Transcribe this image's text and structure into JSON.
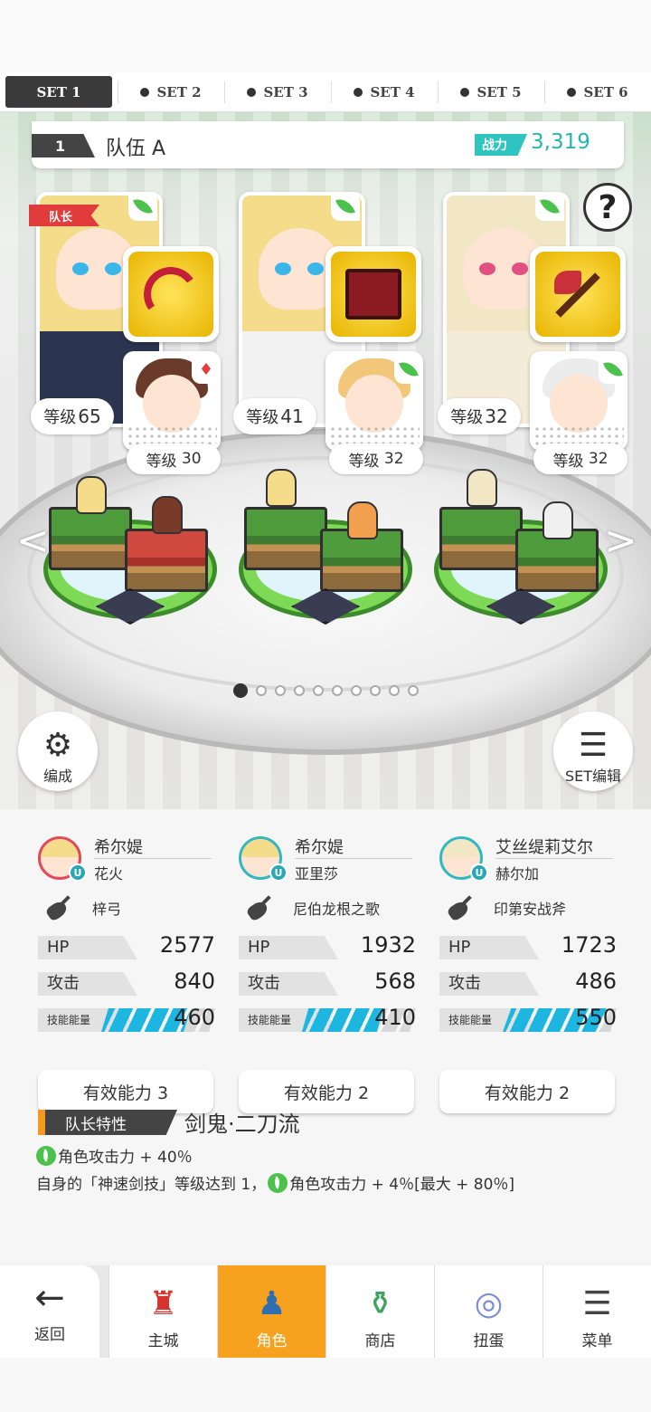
{
  "set_tabs": [
    {
      "label": "SET 1",
      "active": true
    },
    {
      "label": "SET 2",
      "active": false
    },
    {
      "label": "SET 3",
      "active": false
    },
    {
      "label": "SET 4",
      "active": false
    },
    {
      "label": "SET 5",
      "active": false
    },
    {
      "label": "SET 6",
      "active": false
    }
  ],
  "team": {
    "number": "1",
    "name": "队伍 A",
    "power_label": "战力",
    "power_value": "3,319"
  },
  "help_glyph": "?",
  "leader_tag": "队长",
  "characters": [
    {
      "level_label": "等级",
      "level": "65",
      "sub_level_label": "等级",
      "sub_level": "30",
      "weapon_icon": "bow-icon",
      "hair": "#f4dc8a",
      "eye": "#3ab6e8",
      "sub_hair": "#6a3a2a",
      "outfit": "#2b3550"
    },
    {
      "level_label": "等级",
      "level": "41",
      "sub_level_label": "等级",
      "sub_level": "32",
      "weapon_icon": "book-icon",
      "hair": "#f4dc8a",
      "eye": "#3ab6e8",
      "sub_hair": "#f2c77a",
      "outfit": "#f2f2f2"
    },
    {
      "level_label": "等级",
      "level": "32",
      "sub_level_label": "等级",
      "sub_level": "32",
      "weapon_icon": "axe-icon",
      "hair": "#f1e7c4",
      "eye": "#e05080",
      "sub_hair": "#ececec",
      "outfit": "#f4ecd8"
    }
  ],
  "page_dots": {
    "total": 10,
    "active": 0
  },
  "buttons": {
    "formation": "编成",
    "set_edit": "SET编辑"
  },
  "members": [
    {
      "name": "希尔媞",
      "outfit": "花火",
      "badge": "U",
      "weapon": "梓弓",
      "hp_label": "HP",
      "hp": "2577",
      "atk_label": "攻击",
      "atk": "840",
      "energy_label": "技能能量",
      "energy": "460",
      "energy_fill": 0.55,
      "ability": "有效能力 3",
      "hair": "#f4dc8a"
    },
    {
      "name": "希尔媞",
      "outfit": "亚里莎",
      "badge": "U",
      "weapon": "尼伯龙根之歌",
      "hp_label": "HP",
      "hp": "1932",
      "atk_label": "攻击",
      "atk": "568",
      "energy_label": "技能能量",
      "energy": "410",
      "energy_fill": 0.5,
      "ability": "有效能力 2",
      "hair": "#f4dc8a"
    },
    {
      "name": "艾丝缇莉艾尔",
      "outfit": "赫尔加",
      "badge": "U",
      "weapon": "印第安战斧",
      "hp_label": "HP",
      "hp": "1723",
      "atk_label": "攻击",
      "atk": "486",
      "energy_label": "技能能量",
      "energy": "550",
      "energy_fill": 0.65,
      "ability": "有效能力 2",
      "hair": "#f1e7c4"
    }
  ],
  "leader_skill": {
    "label": "队长特性",
    "name": "剑鬼·二刀流",
    "line1": "角色攻击力 + 40％",
    "line2_prefix": "自身的「神速剑技」等级达到 1，",
    "line2_suffix": "角色攻击力 + 4％[最大 + 80％]"
  },
  "nav": {
    "back": "返回",
    "items": [
      {
        "label": "主城",
        "icon": "castle-icon",
        "active": false
      },
      {
        "label": "角色",
        "icon": "character-icon",
        "active": true
      },
      {
        "label": "商店",
        "icon": "shop-icon",
        "active": false
      },
      {
        "label": "扭蛋",
        "icon": "gacha-icon",
        "active": false
      },
      {
        "label": "菜单",
        "icon": "menu-icon",
        "active": false
      }
    ]
  },
  "colors": {
    "accent": "#f7a21e",
    "power": "#2ec4c0",
    "leader": "#e23b3b",
    "element": "#4cc24c",
    "energy": "#1db6e0"
  }
}
